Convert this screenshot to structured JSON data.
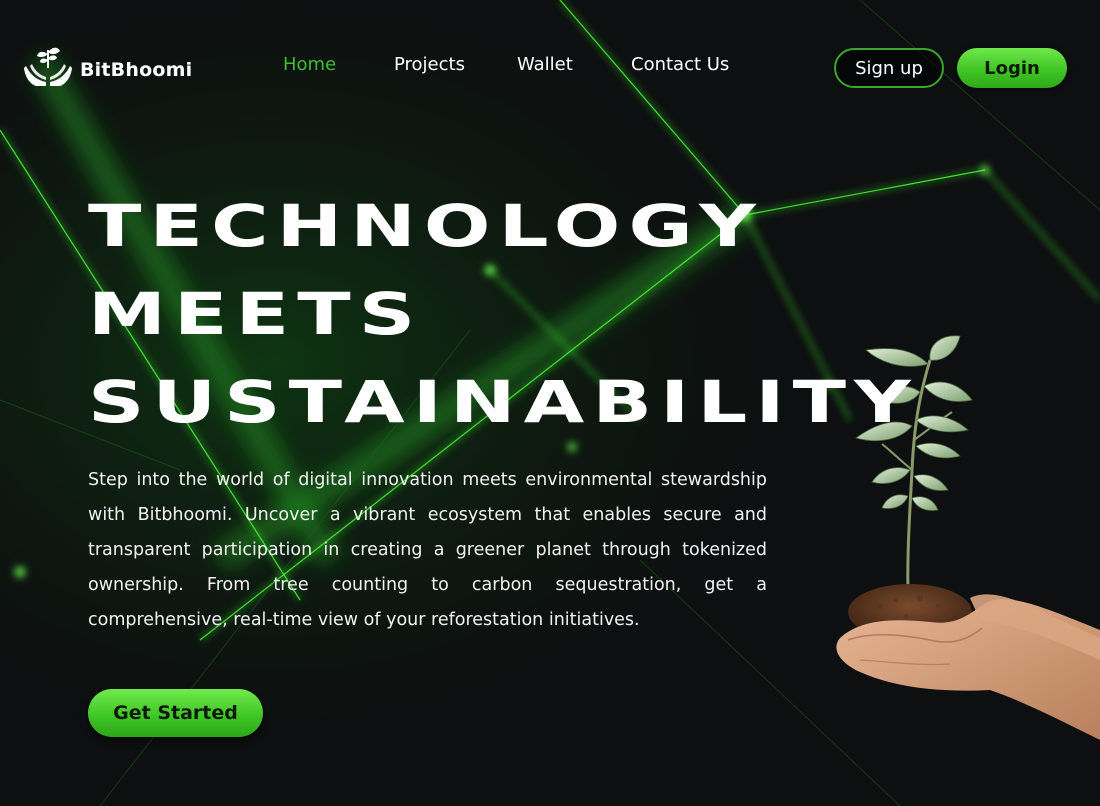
{
  "brand": {
    "name": "BitBhoomi",
    "logo_icon": "hands-sprout-icon"
  },
  "nav": {
    "items": [
      {
        "label": "Home",
        "active": true
      },
      {
        "label": "Projects",
        "active": false
      },
      {
        "label": "Wallet",
        "active": false
      },
      {
        "label": "Contact Us",
        "active": false
      }
    ]
  },
  "auth": {
    "signup_label": "Sign up",
    "login_label": "Login"
  },
  "hero": {
    "title_lines": [
      "TECHNOLOGY",
      "MEETS",
      "SUSTAINABILITY"
    ],
    "description": "Step into the world of digital innovation meets environmental stewardship with Bitbhoomi. Uncover a vibrant ecosystem that enables secure and transparent participation in creating a greener planet through tokenized ownership. From tree counting to carbon sequestration, get a comprehensive, real-time view of your reforestation initiatives.",
    "cta_label": "Get Started",
    "image_icon": "hands-holding-sapling-icon"
  },
  "colors": {
    "accent": "#3fbf30",
    "button_green": "#43c928",
    "background": "#0d0f10",
    "text": "#ffffff"
  }
}
